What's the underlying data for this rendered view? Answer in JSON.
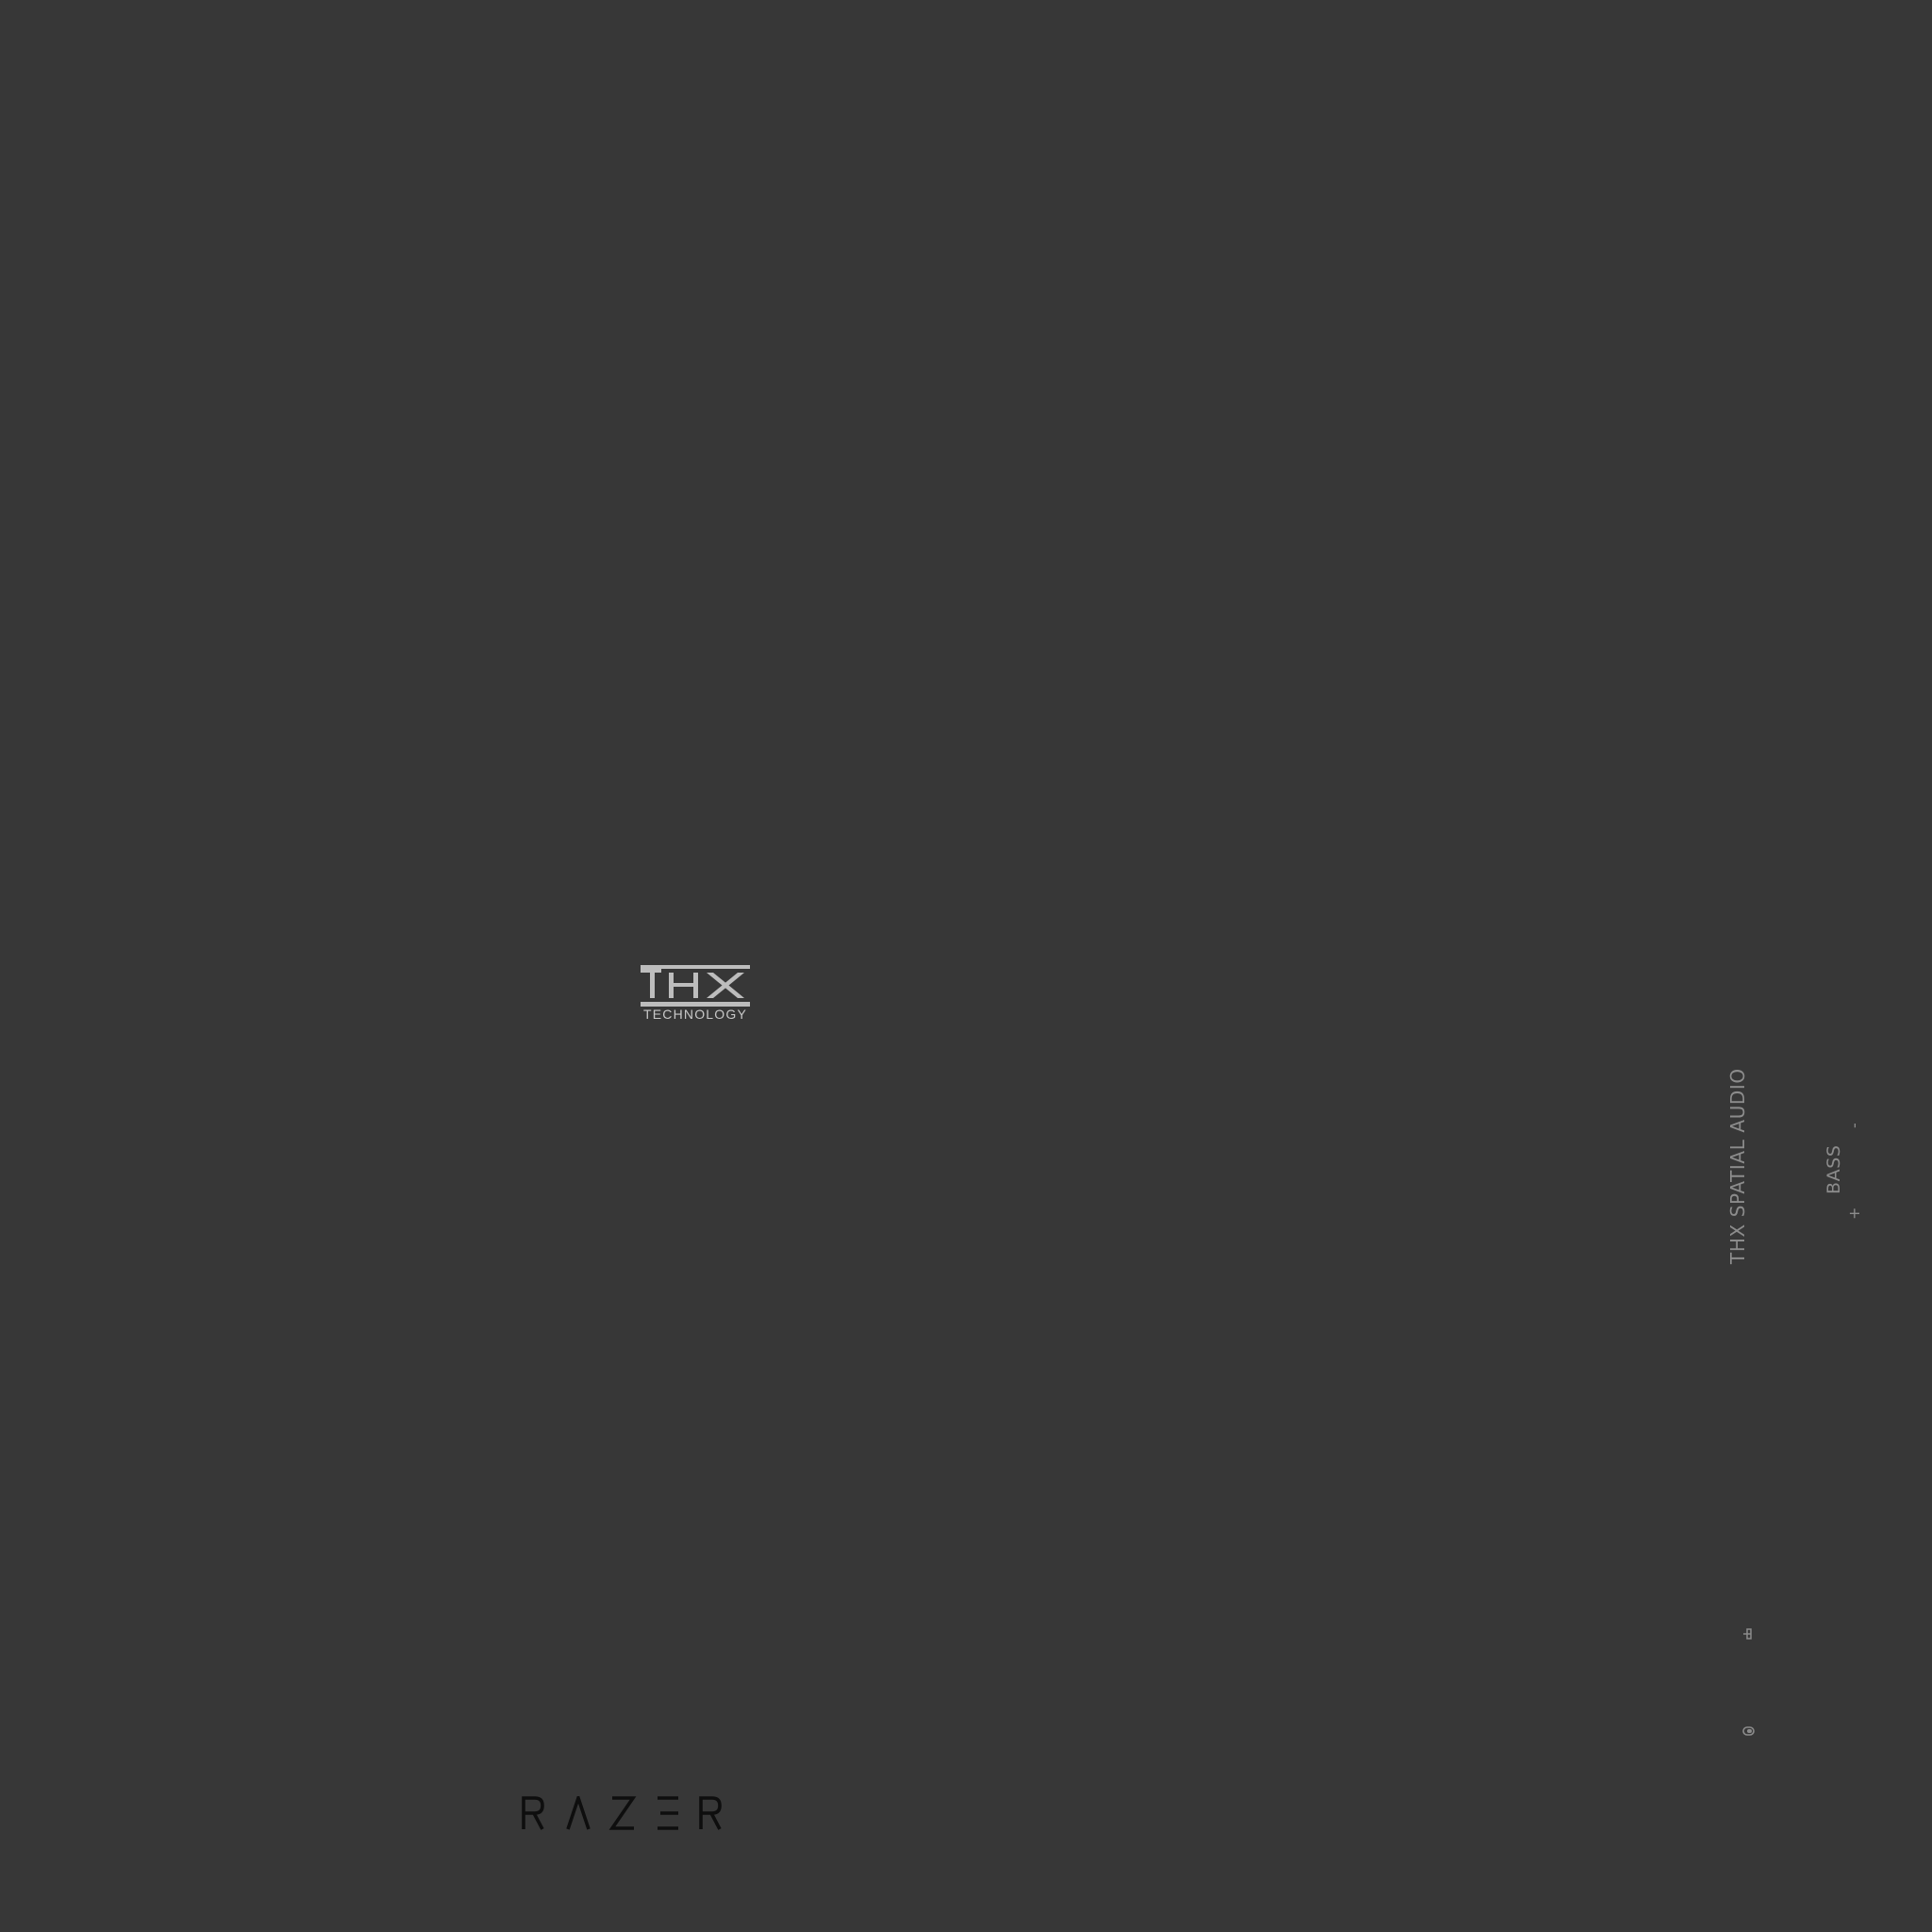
{
  "logos": {
    "thx_wordmark": "THX",
    "thx_subtitle": "TECHNOLOGY",
    "razer_wordmark": "RAZER"
  },
  "controls": {
    "thx_spatial_audio_label": "THX SPATIAL AUDIO",
    "bass_label": "BASS",
    "bass_decrease": "-",
    "bass_increase": "+"
  },
  "icons": {
    "slider": "slider-icon",
    "mic": "mic-icon"
  },
  "colors": {
    "background": "#373737",
    "label_gray": "#8c8c8c",
    "thx_logo": "#bdbdbd",
    "razer_logo": "#0e0e0e"
  }
}
